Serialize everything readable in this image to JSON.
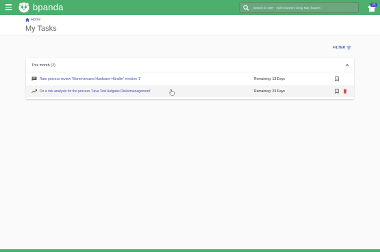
{
  "app": {
    "title": "bpanda"
  },
  "search": {
    "placeholder": "Search in SBT - April showers bring May flowers"
  },
  "notifications": {
    "count": "25"
  },
  "breadcrumb": {
    "home_label": "Home"
  },
  "page": {
    "title": "My Tasks"
  },
  "filter": {
    "label": "FILTER"
  },
  "group": {
    "title": "This month (2)",
    "tasks": [
      {
        "icon": "feedback-icon",
        "label": "Rate process review 'Warenversand Hardware-Händler' revision '1'",
        "remaining": "Remaining: 13 Days"
      },
      {
        "icon": "trending-up-icon",
        "label": "Do a risk analysis for the process 'Java Test Aufgabe Risikomanagement'",
        "remaining": "Remaining: 23 Days"
      }
    ]
  },
  "colors": {
    "brand": "#4caf6e",
    "accent": "#3f51b5",
    "delete": "#e53935"
  }
}
